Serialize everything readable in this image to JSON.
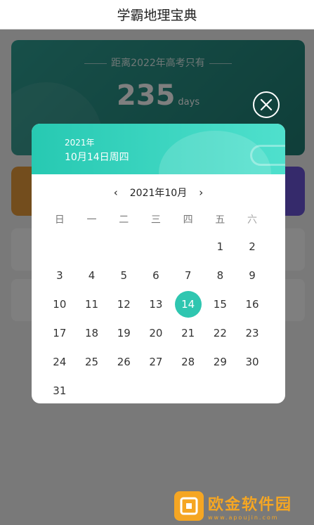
{
  "app": {
    "title": "学霸地理宝典"
  },
  "countdown": {
    "label": "距离2022年高考只有",
    "days": "235",
    "unit": "days"
  },
  "calendar": {
    "year": "2021年",
    "selected_date": "10月14日周四",
    "month_label": "2021年10月",
    "prev_icon": "‹",
    "next_icon": "›",
    "weekdays": [
      "日",
      "一",
      "二",
      "三",
      "四",
      "五",
      "六"
    ],
    "first_weekday_index": 5,
    "days": [
      "1",
      "2",
      "3",
      "4",
      "5",
      "6",
      "7",
      "8",
      "9",
      "10",
      "11",
      "12",
      "13",
      "14",
      "15",
      "16",
      "17",
      "18",
      "19",
      "20",
      "21",
      "22",
      "23",
      "24",
      "25",
      "26",
      "27",
      "28",
      "29",
      "30",
      "31"
    ],
    "selected_day": "14",
    "accent_color": "#2fc6b0"
  },
  "icons": {
    "close": "close-circle-icon"
  },
  "watermark": {
    "title": "欧金软件园",
    "subtitle": "www.apoujin.com"
  }
}
